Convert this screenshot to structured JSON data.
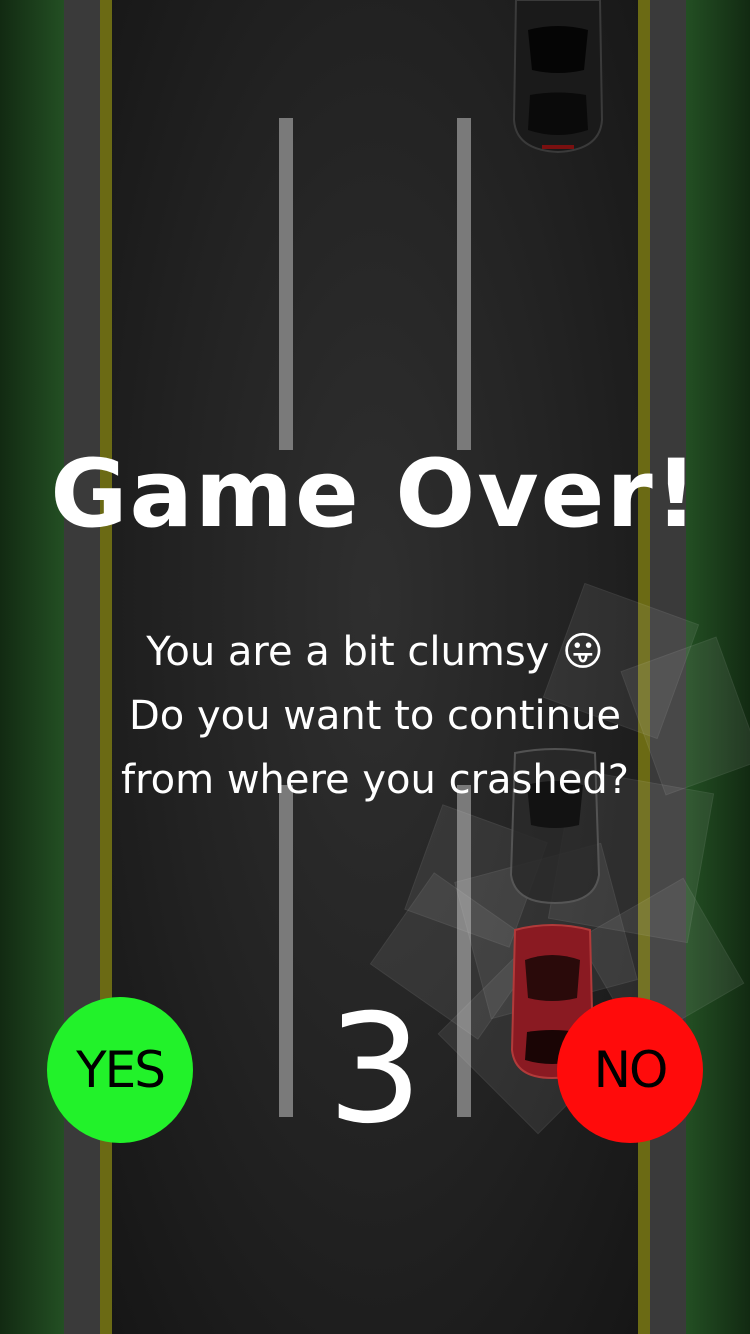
{
  "title": "Game Over!",
  "message": {
    "line1": "You are a bit clumsy 😛",
    "line2": "Do you want to continue",
    "line3": "from where you crashed?"
  },
  "countdown": "3",
  "buttons": {
    "yes_label": "YES",
    "no_label": "NO",
    "yes_color": "#22f22a",
    "no_color": "#ff0b0b"
  },
  "colors": {
    "grass": "#234f23",
    "road": "#222222",
    "edge_line": "#6b6a14",
    "lane_mark": "#7a7a7a",
    "player_car": "#8a1a22",
    "traffic_car": "#111111"
  }
}
